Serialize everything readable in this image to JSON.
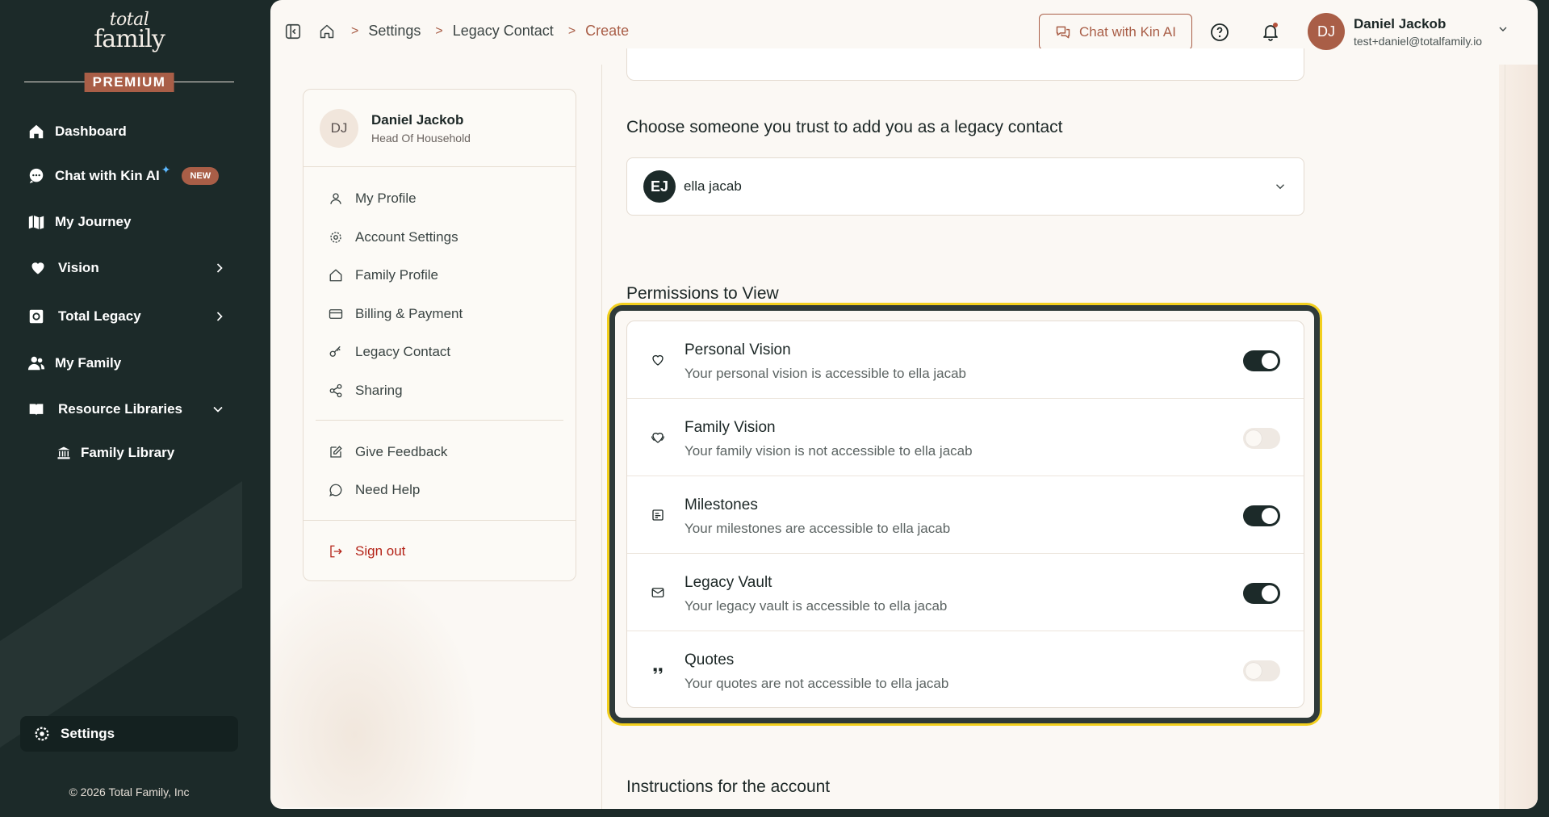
{
  "sidebar": {
    "logo_line1": "total",
    "logo_line2": "family",
    "premium": "PREMIUM",
    "items": [
      {
        "label": "Dashboard"
      },
      {
        "label": "Chat with Kin AI",
        "badge": "NEW"
      },
      {
        "label": "My Journey"
      },
      {
        "label": "Vision"
      },
      {
        "label": "Total Legacy"
      },
      {
        "label": "My Family"
      },
      {
        "label": "Resource Libraries"
      },
      {
        "label": "Family Library"
      }
    ],
    "settings": "Settings",
    "copyright": "© 2026 Total Family, Inc"
  },
  "topbar": {
    "breadcrumb": [
      "Settings",
      "Legacy Contact",
      "Create"
    ],
    "chat_button": "Chat with Kin AI",
    "user_initials": "DJ",
    "user_name": "Daniel Jackob",
    "user_email": "test+daniel@totalfamily.io"
  },
  "profile_card": {
    "initials": "DJ",
    "name": "Daniel Jackob",
    "role": "Head Of Household",
    "menu": [
      {
        "label": "My Profile"
      },
      {
        "label": "Account Settings"
      },
      {
        "label": "Family Profile"
      },
      {
        "label": "Billing & Payment"
      },
      {
        "label": "Legacy Contact"
      },
      {
        "label": "Sharing"
      }
    ],
    "feedback": "Give Feedback",
    "help": "Need Help",
    "signout": "Sign out"
  },
  "content": {
    "trust_heading": "Choose someone you trust to add you as a legacy contact",
    "selected_contact": {
      "initials": "EJ",
      "name": "ella jacab"
    },
    "permissions_heading": "Permissions to View",
    "permissions": [
      {
        "icon": "heart-icon",
        "title": "Personal Vision",
        "desc": "Your personal vision is accessible to ella jacab",
        "enabled": true
      },
      {
        "icon": "family-heart-icon",
        "title": "Family Vision",
        "desc": "Your family vision is not accessible to ella jacab",
        "enabled": false
      },
      {
        "icon": "milestone-icon",
        "title": "Milestones",
        "desc": "Your milestones are accessible to ella jacab",
        "enabled": true
      },
      {
        "icon": "envelope-icon",
        "title": "Legacy Vault",
        "desc": "Your legacy vault is accessible to ella jacab",
        "enabled": true
      },
      {
        "icon": "quote-icon",
        "title": "Quotes",
        "desc": "Your quotes are not accessible to ella jacab",
        "enabled": false
      }
    ],
    "instructions_heading": "Instructions for the account"
  },
  "colors": {
    "sidebar_bg": "#1c2a29",
    "accent": "#a95e47",
    "highlight": "#f2cf1d",
    "toggle_on": "#1c2a29"
  }
}
